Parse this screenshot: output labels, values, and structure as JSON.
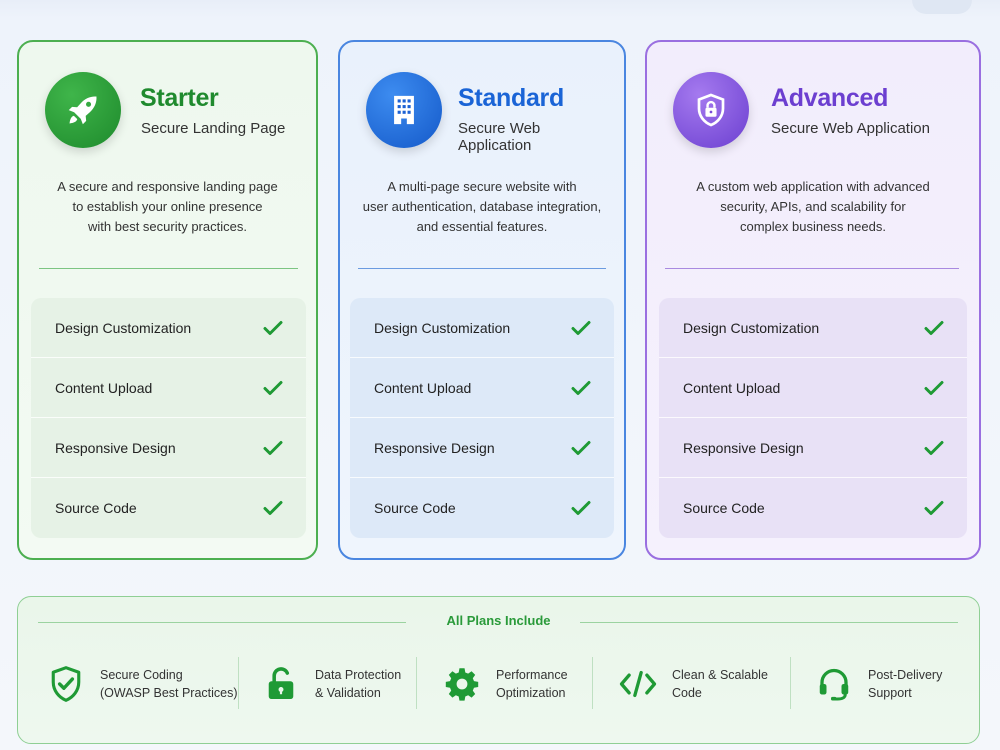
{
  "plans": [
    {
      "name": "Starter",
      "subtitle": "Secure Landing Page",
      "icon": "rocket-icon",
      "accent": "#1f8a2e",
      "description": [
        "A secure and responsive landing page",
        "to establish your online presence",
        "with best security practices."
      ],
      "features": [
        "Design Customization",
        "Content Upload",
        "Responsive Design",
        "Source Code"
      ]
    },
    {
      "name": "Standard",
      "subtitle": "Secure Web Application",
      "icon": "building-icon",
      "accent": "#1a64d6",
      "description": [
        "A multi-page secure website with",
        "user authentication, database integration,",
        "and essential features."
      ],
      "features": [
        "Design Customization",
        "Content Upload",
        "Responsive Design",
        "Source Code"
      ]
    },
    {
      "name": "Advanced",
      "subtitle": "Secure Web Application",
      "icon": "lock-shield-icon",
      "accent": "#6c3fd0",
      "description": [
        "A custom web application with advanced",
        "security, APIs, and scalability for",
        "complex business needs."
      ],
      "features": [
        "Design Customization",
        "Content Upload",
        "Responsive Design",
        "Source Code"
      ]
    }
  ],
  "includes": {
    "title": "All Plans Include",
    "items": [
      {
        "line1": "Secure Coding",
        "line2": "(OWASP Best Practices)",
        "icon": "shield-check-icon"
      },
      {
        "line1": "Data Protection",
        "line2": "& Validation",
        "icon": "unlocked-padlock-icon"
      },
      {
        "line1": "Performance",
        "line2": "Optimization",
        "icon": "gear-icon"
      },
      {
        "line1": "Clean & Scalable",
        "line2": "Code",
        "icon": "code-icon"
      },
      {
        "line1": "Post-Delivery",
        "line2": "Support",
        "icon": "headset-icon"
      }
    ]
  },
  "colors": {
    "check": "#1f9a35",
    "includes_icon": "#1f9a35"
  }
}
